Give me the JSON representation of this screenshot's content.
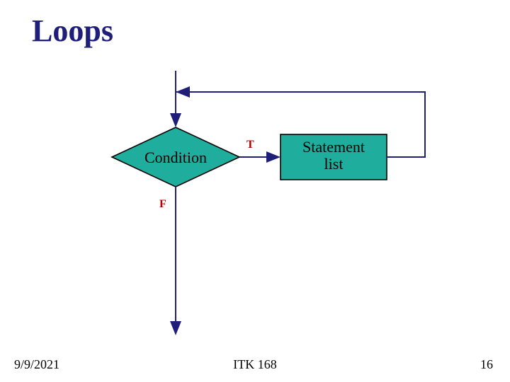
{
  "title": "Loops",
  "flow": {
    "condition_label": "Condition",
    "statement_label_line1": "Statement",
    "statement_label_line2": "list",
    "true_label": "T",
    "false_label": "F"
  },
  "footer": {
    "date": "9/9/2021",
    "course": "ITK 168",
    "slide_number": "16"
  },
  "colors": {
    "shape_fill": "#1fae9e",
    "shape_stroke": "#000000",
    "arrow": "#1f1f7a",
    "title": "#1f1f7a",
    "tf_label": "#b00000"
  }
}
